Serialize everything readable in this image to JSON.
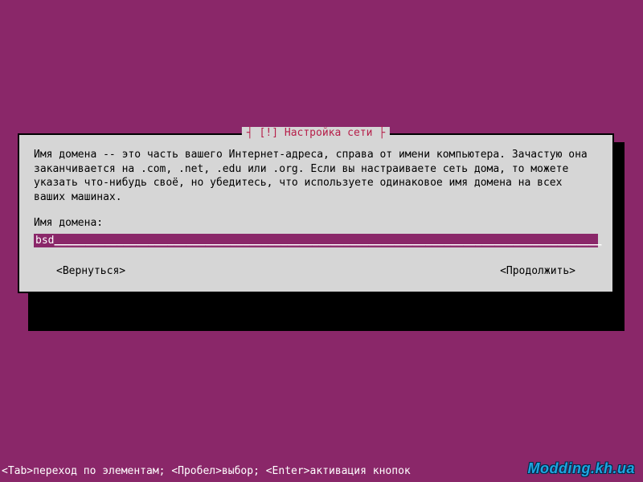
{
  "dialog": {
    "title": "┤ [!] Настройка сети ├",
    "description": "Имя домена -- это часть вашего Интернет-адреса, справа от имени компьютера. Зачастую она заканчивается на .com, .net, .edu или .org. Если вы настраиваете сеть дома, то можете указать что-нибудь своё, но убедитесь, что используете одинаковое имя домена на всех ваших машинах.",
    "prompt_label": "Имя домена:",
    "input_value": "bsd",
    "input_pad": "_______________________________________________________________________________________",
    "back_label": "<Вернуться>",
    "continue_label": "<Продолжить>"
  },
  "helpbar": "<Tab>переход по элементам; <Пробел>выбор; <Enter>активация кнопок",
  "watermark": "Modding.kh.ua"
}
